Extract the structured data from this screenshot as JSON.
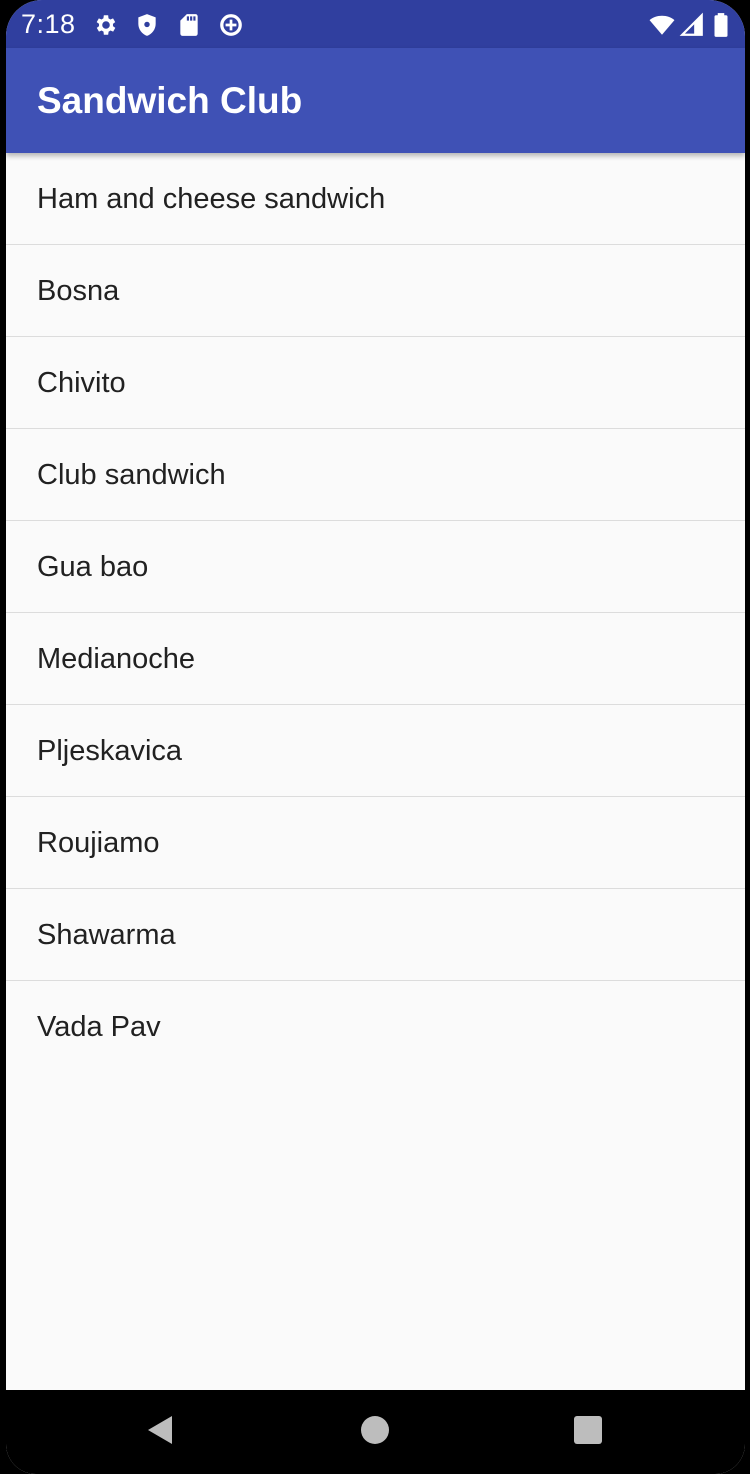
{
  "status_bar": {
    "time": "7:18",
    "left_icons": [
      "gear-icon",
      "shield-icon",
      "sd-card-icon",
      "data-saver-icon"
    ],
    "right_icons": [
      "wifi-icon",
      "cell-signal-icon",
      "battery-icon"
    ],
    "color": "#303f9f"
  },
  "app_bar": {
    "title": "Sandwich Club",
    "color": "#3f51b5"
  },
  "sandwich_list": {
    "items": [
      {
        "label": "Ham and cheese sandwich"
      },
      {
        "label": "Bosna"
      },
      {
        "label": "Chivito"
      },
      {
        "label": "Club sandwich"
      },
      {
        "label": "Gua bao"
      },
      {
        "label": "Medianoche"
      },
      {
        "label": "Pljeskavica"
      },
      {
        "label": "Roujiamo"
      },
      {
        "label": "Shawarma"
      },
      {
        "label": "Vada Pav"
      }
    ]
  },
  "nav_bar": {
    "buttons": [
      "back-icon",
      "home-icon",
      "recents-icon"
    ]
  }
}
